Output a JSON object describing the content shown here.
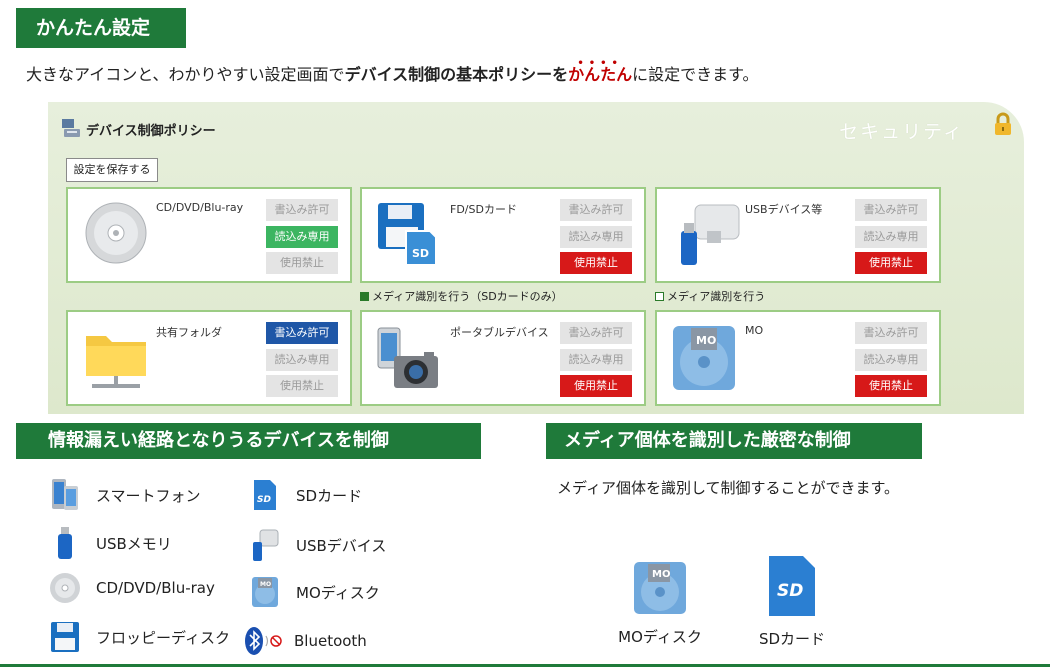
{
  "header": {
    "title": "かんたん設定"
  },
  "intro": {
    "part1": "大きなアイコンと、わかりやすい設定画面で",
    "bold": "デバイス制御の基本ポリシーを",
    "red": "かんたん",
    "part2": "に設定できます。",
    "dots": "••••"
  },
  "panel": {
    "title": "デバイス制御ポリシー",
    "section": "セキュリティ",
    "save_label": "設定を保存する",
    "cards": [
      {
        "label": "CD/DVD/Blu-ray",
        "buttons": [
          "書込み許可",
          "読込み専用",
          "使用禁止"
        ],
        "icon": "disc-icon"
      },
      {
        "label": "FD/SDカード",
        "buttons": [
          "書込み許可",
          "読込み専用",
          "使用禁止"
        ],
        "icon": "floppy-sd-icon"
      },
      {
        "label": "USBデバイス等",
        "buttons": [
          "書込み許可",
          "読込み専用",
          "使用禁止"
        ],
        "icon": "usb-device-icon"
      },
      {
        "label": "共有フォルダ",
        "buttons": [
          "書込み許可",
          "読込み専用",
          "使用禁止"
        ],
        "icon": "shared-folder-icon"
      },
      {
        "label": "ポータブルデバイス",
        "buttons": [
          "書込み許可",
          "読込み専用",
          "使用禁止"
        ],
        "icon": "portable-device-icon"
      },
      {
        "label": "MO",
        "buttons": [
          "書込み許可",
          "読込み専用",
          "使用禁止"
        ],
        "icon": "mo-disk-icon"
      }
    ],
    "checks": [
      {
        "label": "メディア識別を行う（SDカードのみ）",
        "checked": true
      },
      {
        "label": "メディア識別を行う",
        "checked": false
      }
    ]
  },
  "leak": {
    "title": "情報漏えい経路となりうるデバイスを制御",
    "devices": [
      {
        "label": "スマートフォン",
        "icon": "smartphone-icon"
      },
      {
        "label": "SDカード",
        "icon": "sd-card-icon"
      },
      {
        "label": "USBメモリ",
        "icon": "usb-memory-icon"
      },
      {
        "label": "USBデバイス",
        "icon": "usb-device-icon"
      },
      {
        "label": "CD/DVD/Blu-ray",
        "icon": "disc-icon"
      },
      {
        "label": "MOディスク",
        "icon": "mo-disk-icon"
      },
      {
        "label": "フロッピーディスク",
        "icon": "floppy-icon"
      },
      {
        "label": "Bluetooth",
        "icon": "bluetooth-icon"
      }
    ]
  },
  "media": {
    "title": "メディア個体を識別した厳密な制御",
    "desc": "メディア個体を識別して制御することができます。",
    "items": [
      {
        "label": "MOディスク",
        "icon": "mo-disk-icon",
        "tag": "MO"
      },
      {
        "label": "SDカード",
        "icon": "sd-card-icon",
        "tag": "SD"
      }
    ]
  },
  "colors": {
    "brand_green": "#1f7a3a",
    "allow_green": "#3cb561",
    "allow_blue": "#1f57a7",
    "deny_red": "#d71919",
    "accent_red": "#c00000"
  }
}
